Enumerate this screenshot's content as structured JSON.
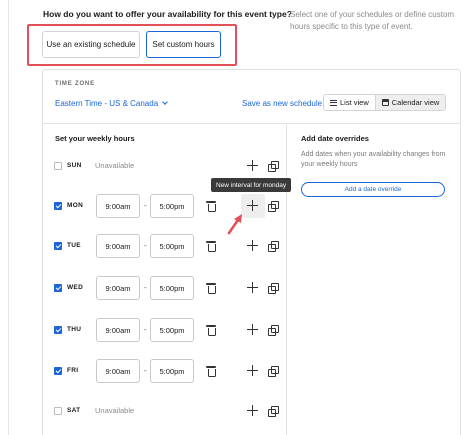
{
  "header": {
    "question": "How do you want to offer your availability for this event type?",
    "help_text": "Select one of your schedules or define custom hours specific to this type of event."
  },
  "options": {
    "existing_label": "Use an existing schedule",
    "custom_label": "Set custom hours",
    "selected": "custom"
  },
  "timezone": {
    "label": "TIME ZONE",
    "value": "Eastern Time - US & Canada"
  },
  "toolbar": {
    "save_label": "Save as new schedule",
    "list_view": "List view",
    "calendar_view": "Calendar view",
    "active_view": "calendar"
  },
  "weekly": {
    "title": "Set your weekly hours",
    "days": [
      {
        "name": "SUN",
        "checked": false,
        "unavailable_label": "Unavailable"
      },
      {
        "name": "MON",
        "checked": true,
        "start": "9:00am",
        "end": "5:00pm"
      },
      {
        "name": "TUE",
        "checked": true,
        "start": "9:00am",
        "end": "5:00pm"
      },
      {
        "name": "WED",
        "checked": true,
        "start": "9:00am",
        "end": "5:00pm"
      },
      {
        "name": "THU",
        "checked": true,
        "start": "9:00am",
        "end": "5:00pm"
      },
      {
        "name": "FRI",
        "checked": true,
        "start": "9:00am",
        "end": "5:00pm"
      },
      {
        "name": "SAT",
        "checked": false,
        "unavailable_label": "Unavailable"
      }
    ],
    "separator": "-"
  },
  "tooltip": {
    "text": "New interval for monday"
  },
  "overrides": {
    "title": "Add date overrides",
    "description": "Add dates when your availability changes from your weekly hours",
    "button_label": "Add a date override"
  },
  "colors": {
    "accent": "#1a66d9",
    "highlight": "#e2505a",
    "arrow": "#e2505a"
  }
}
